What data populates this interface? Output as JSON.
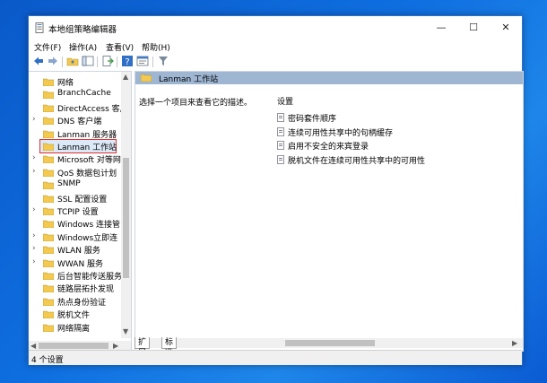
{
  "window": {
    "title": "本地组策略编辑器",
    "minimize": "—",
    "maximize": "☐",
    "close": "✕"
  },
  "menu": {
    "file": "文件(F)",
    "action": "操作(A)",
    "view": "查看(V)",
    "help": "帮助(H)"
  },
  "tree": {
    "items": [
      {
        "label": "网络",
        "expandable": false
      },
      {
        "label": "BranchCache",
        "expandable": false
      },
      {
        "label": "DirectAccess 客户",
        "expandable": false
      },
      {
        "label": "DNS 客户端",
        "expandable": true
      },
      {
        "label": "Lanman 服务器",
        "expandable": false
      },
      {
        "label": "Lanman 工作站",
        "expandable": false,
        "selected": true
      },
      {
        "label": "Microsoft 对等网",
        "expandable": true
      },
      {
        "label": "QoS 数据包计划",
        "expandable": true
      },
      {
        "label": "SNMP",
        "expandable": false
      },
      {
        "label": "SSL 配置设置",
        "expandable": false
      },
      {
        "label": "TCPIP 设置",
        "expandable": true
      },
      {
        "label": "Windows 连接管",
        "expandable": false
      },
      {
        "label": "Windows立即连",
        "expandable": true
      },
      {
        "label": "WLAN 服务",
        "expandable": true
      },
      {
        "label": "WWAN 服务",
        "expandable": true
      },
      {
        "label": "后台智能传送服务",
        "expandable": false
      },
      {
        "label": "链路层拓扑发现",
        "expandable": false
      },
      {
        "label": "热点身份验证",
        "expandable": false
      },
      {
        "label": "脱机文件",
        "expandable": false
      },
      {
        "label": "网络隔离",
        "expandable": false
      }
    ]
  },
  "content": {
    "header": "Lanman 工作站",
    "description": "选择一个项目来查看它的描述。",
    "settings_heading": "设置",
    "settings": [
      "密码套件顺序",
      "连续可用性共享中的句柄缓存",
      "启用不安全的来宾登录",
      "脱机文件在连续可用性共享中的可用性"
    ]
  },
  "tabs": {
    "extended": "扩展",
    "standard": "标准"
  },
  "status": {
    "text": "4 个设置"
  },
  "colors": {
    "header_strip": "#9eb6d2",
    "selection_outline": "#e03030",
    "folder": "#f3c94f"
  }
}
